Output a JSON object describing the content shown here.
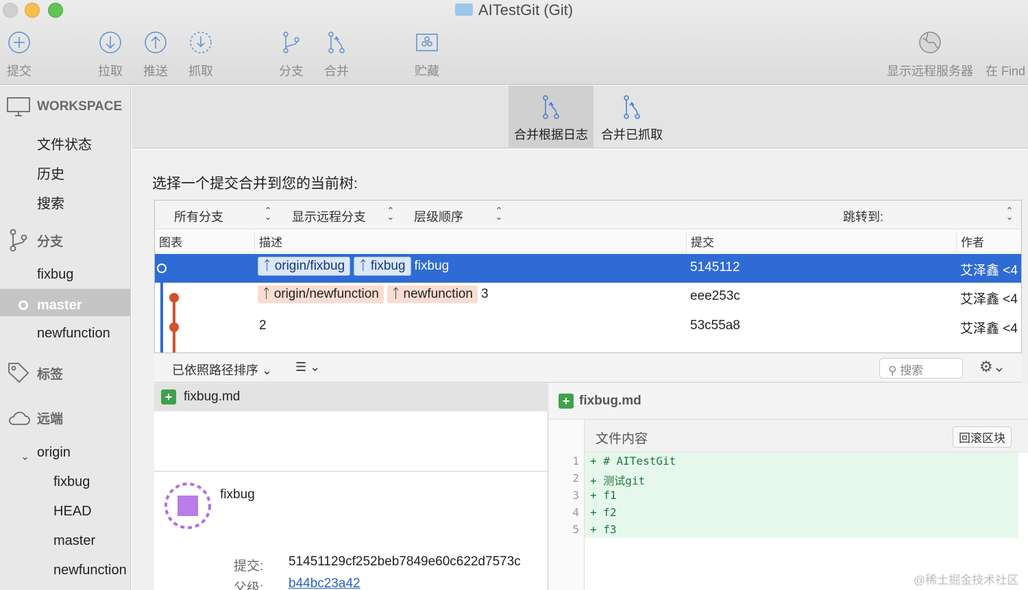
{
  "window": {
    "title": "AITestGit (Git)"
  },
  "toolbar": {
    "commit": "提交",
    "pull": "拉取",
    "push": "推送",
    "fetch": "抓取",
    "branch": "分支",
    "merge": "合并",
    "stash": "贮藏",
    "show_remote": "显示远程服务器",
    "finder": "在 Find"
  },
  "sidebar": {
    "workspace": "WORKSPACE",
    "file_status": "文件状态",
    "history": "历史",
    "search": "搜索",
    "branches": "分支",
    "branch_items": [
      "fixbug",
      "master",
      "newfunction"
    ],
    "tags": "标签",
    "remotes": "远端",
    "origin": "origin",
    "origin_items": [
      "fixbug",
      "HEAD",
      "master",
      "newfunction"
    ]
  },
  "modes": {
    "merge_log": "合并根据日志",
    "merge_fetched": "合并已抓取"
  },
  "main": {
    "prompt": "选择一个提交合并到您的当前树:",
    "filters": {
      "all_branches": "所有分支",
      "show_remote": "显示远程分支",
      "order": "层级顺序",
      "jump_to": "跳转到:"
    },
    "columns": {
      "graph": "图表",
      "description": "描述",
      "commit": "提交",
      "author": "作者"
    },
    "rows": [
      {
        "tags": [
          "origin/fixbug",
          "fixbug"
        ],
        "message": "fixbug",
        "commit": "5145112",
        "author": "艾泽鑫 <4"
      },
      {
        "tags": [
          "origin/newfunction",
          "newfunction"
        ],
        "message": "3",
        "commit": "eee253c",
        "author": "艾泽鑫 <4"
      },
      {
        "tags": [],
        "message": "2",
        "commit": "53c55a8",
        "author": "艾泽鑫 <4"
      }
    ]
  },
  "filelist": {
    "sort_label": "已依照路径排序",
    "search_placeholder": "搜索",
    "file": "fixbug.md"
  },
  "commit_detail": {
    "message": "fixbug",
    "commit_label": "提交:",
    "commit_hash": "51451129cf252beb7849e60c622d7573c",
    "parent_label": "父级:",
    "parent_hash": "b44bc23a42"
  },
  "diff": {
    "file": "fixbug.md",
    "hunk_title": "文件内容",
    "revert_button": "回滚区块",
    "lines": [
      {
        "no": "1",
        "text": "+ # AITestGit"
      },
      {
        "no": "2",
        "text": "+ 测试git"
      },
      {
        "no": "3",
        "text": "+ f1"
      },
      {
        "no": "4",
        "text": "+ f2"
      },
      {
        "no": "5",
        "text": "+ f3"
      }
    ]
  },
  "watermark": "@稀土掘金技术社区",
  "colors": {
    "selection": "#2f6bd4",
    "branch_red": "#d4512d",
    "added_bg": "#e6f8ec",
    "add_icon": "#3fa14d"
  }
}
